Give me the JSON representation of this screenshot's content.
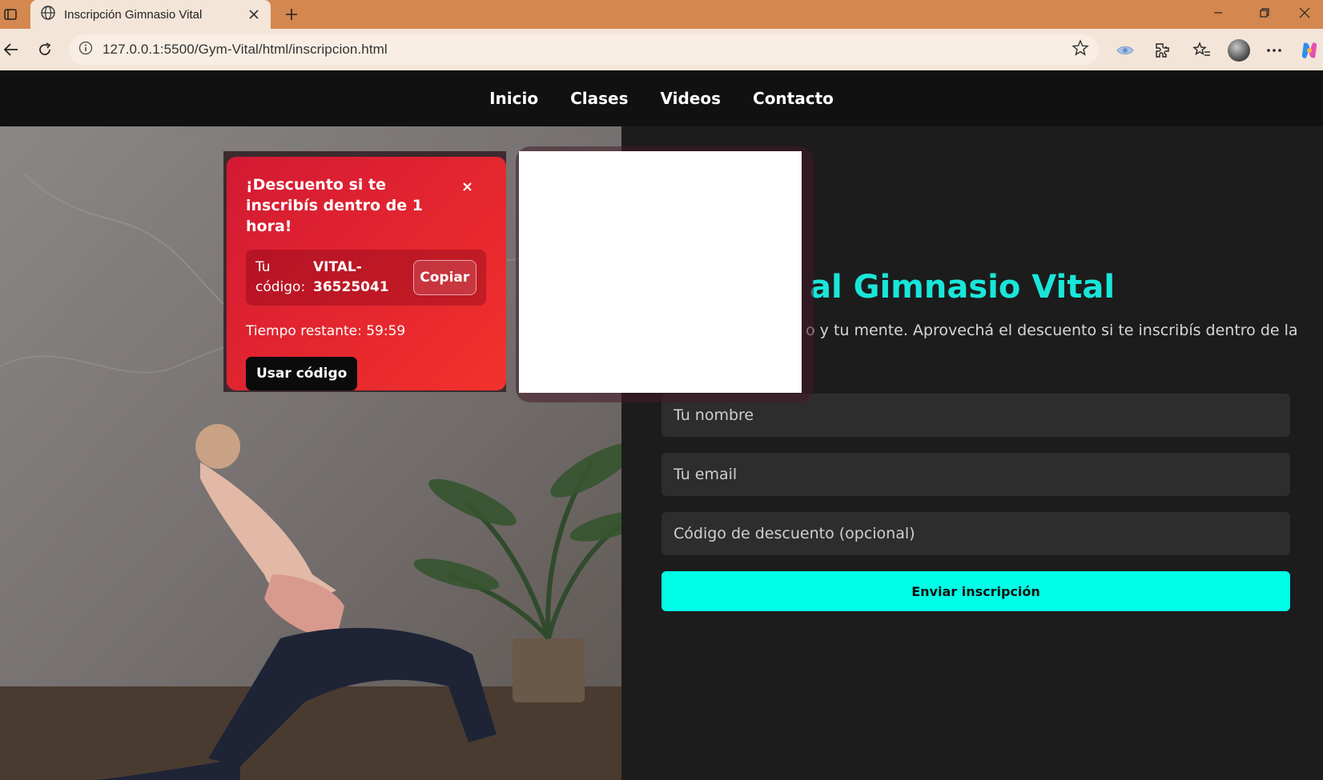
{
  "browser": {
    "tab_title": "Inscripción Gimnasio Vital",
    "url": "127.0.0.1:5500/Gym-Vital/html/inscripcion.html"
  },
  "nav": {
    "items": [
      {
        "label": "Inicio"
      },
      {
        "label": "Clases"
      },
      {
        "label": "Videos"
      },
      {
        "label": "Contacto"
      }
    ]
  },
  "hero": {
    "heading": "al Gimnasio Vital",
    "subtitle": "o y tu mente. Aprovechá el descuento si te inscribís dentro de la"
  },
  "form": {
    "name_placeholder": "Tu nombre",
    "email_placeholder": "Tu email",
    "code_placeholder": "Código de descuento (opcional)",
    "submit_label": "Enviar inscripción"
  },
  "popup": {
    "title": "¡Descuento si te inscribís dentro de 1 hora!",
    "code_label": "Tu código:",
    "code_value": "VITAL-36525041",
    "copy_label": "Copiar",
    "timer_text": "Tiempo restante: 59:59",
    "use_label": "Usar código"
  },
  "colors": {
    "accent": "#00ffe6",
    "heading": "#19e6da",
    "popup": "#e4262f",
    "chrome": "#d4874f"
  }
}
